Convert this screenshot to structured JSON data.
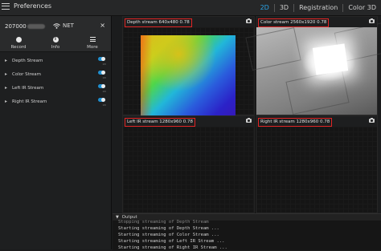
{
  "app": {
    "preferences_label": "Preferences"
  },
  "view_tabs": [
    "2D",
    "3D",
    "Registration",
    "Color 3D"
  ],
  "device": {
    "name": "207000",
    "connection": "NET",
    "close_symbol": "×"
  },
  "actions": [
    {
      "label": "Record",
      "icon": "record-icon"
    },
    {
      "label": "Info",
      "icon": "info-icon"
    },
    {
      "label": "More",
      "icon": "menu-icon"
    }
  ],
  "streams": [
    {
      "label": "Depth Stream",
      "state": "on"
    },
    {
      "label": "Color Stream",
      "state": "on"
    },
    {
      "label": "Left IR Stream",
      "state": "on"
    },
    {
      "label": "Right IR Stream",
      "state": "on"
    }
  ],
  "panes": [
    {
      "tag": "Depth stream  640x480  0.78"
    },
    {
      "tag": "Color stream  2560x1920  0.78"
    },
    {
      "tag": "Left IR stream  1280x960  0.78"
    },
    {
      "tag": "Right IR stream  1280x960  0.78"
    }
  ],
  "output": {
    "title": "Output",
    "lines": [
      "Stopping streaming of Depth Stream",
      "Starting streaming of Depth Stream ...",
      "Starting streaming of Color Stream ...",
      "Starting streaming of Left IR Stream ...",
      "Starting streaming of Right IR Stream ..."
    ]
  },
  "colors": {
    "accent": "#2aa4e8",
    "highlight_box": "#e02424",
    "toggle_on": "#1f8fd0"
  }
}
